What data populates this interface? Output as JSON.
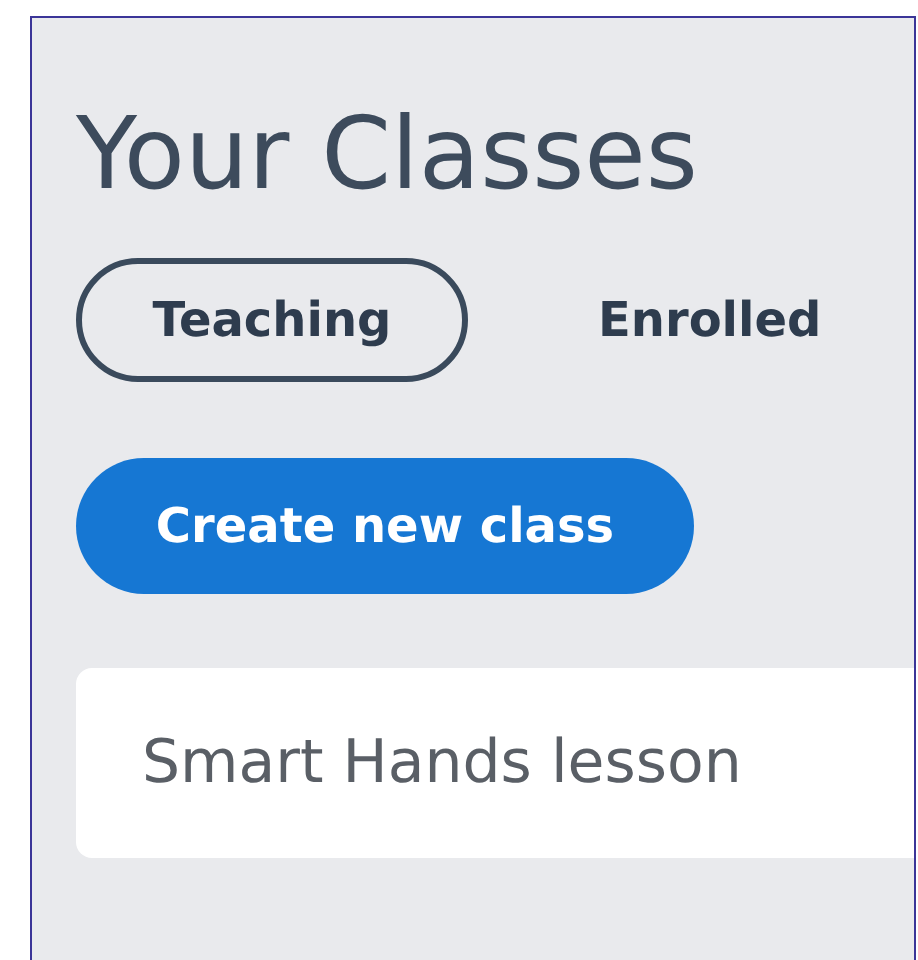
{
  "title": "Your Classes",
  "tabs": [
    {
      "label": "Teaching",
      "selected": true
    },
    {
      "label": "Enrolled",
      "selected": false
    }
  ],
  "create_button": "Create new class",
  "classes": [
    {
      "name": "Smart Hands lesson"
    }
  ]
}
